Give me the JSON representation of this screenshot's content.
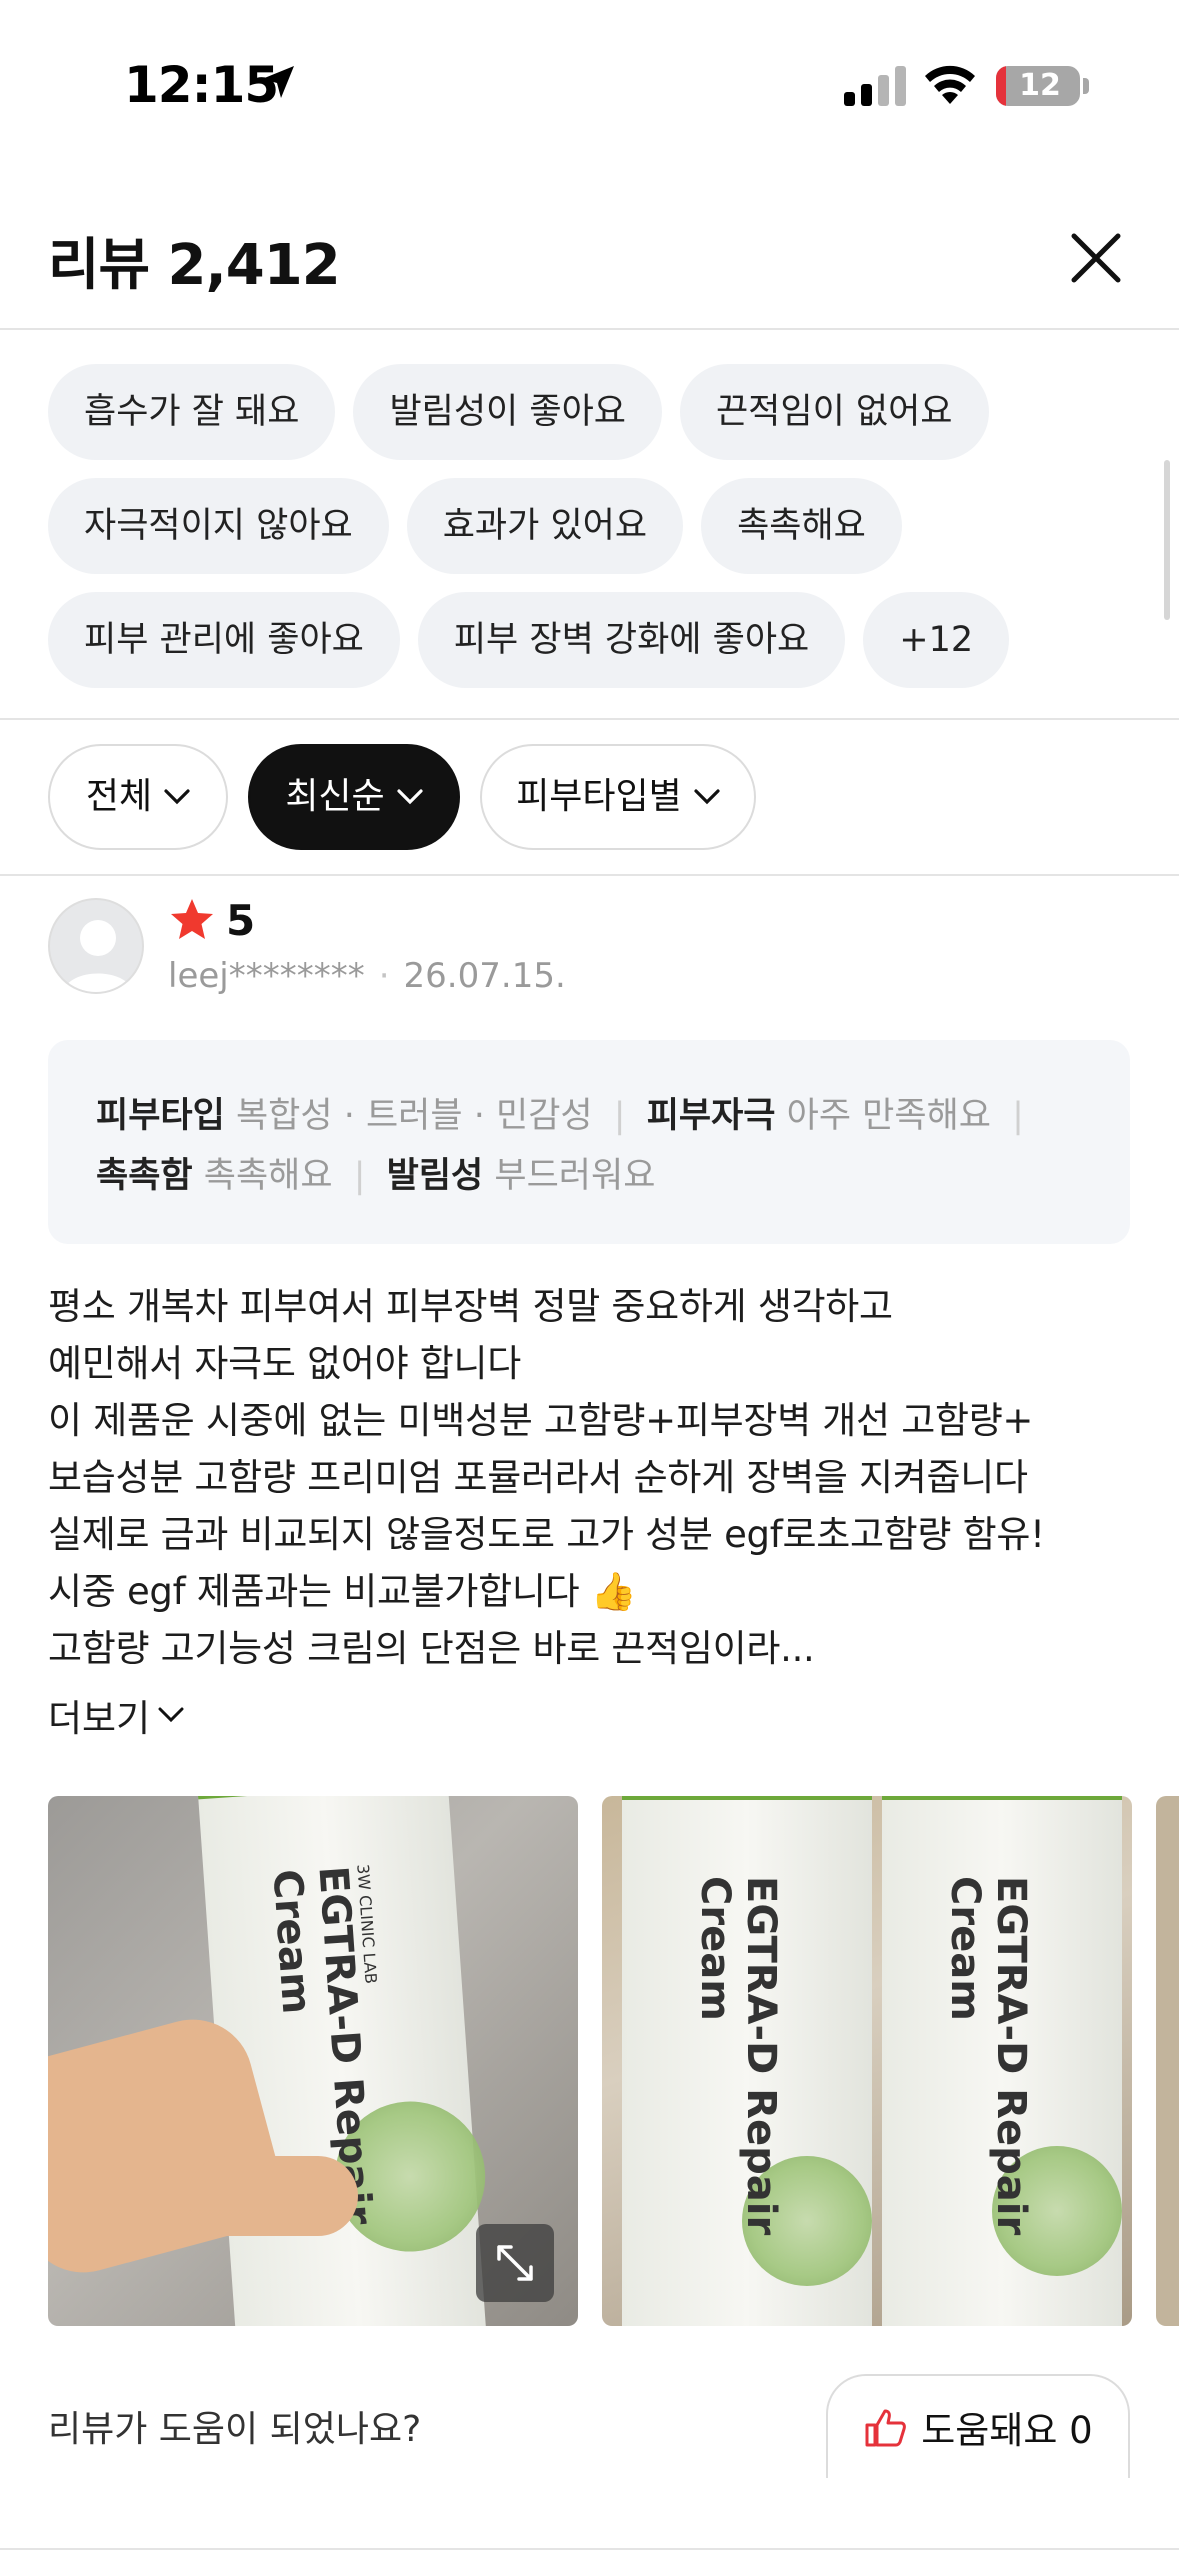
{
  "status_bar": {
    "time": "12:15",
    "battery_level": "12",
    "battery_fraction": 0.12
  },
  "header": {
    "title": "리뷰 2,412",
    "close_icon": "close-icon"
  },
  "keywords": {
    "rows": [
      [
        "흡수가 잘 돼요",
        "발림성이 좋아요",
        "끈적임이 없어요"
      ],
      [
        "자극적이지 않아요",
        "효과가 있어요",
        "촉촉해요"
      ],
      [
        "피부 관리에 좋아요",
        "피부 장벽 강화에 좋아요",
        "+12"
      ]
    ]
  },
  "sort": {
    "all": "전체",
    "latest": "최신순",
    "skin_type": "피부타입별"
  },
  "review": {
    "rating": "5",
    "author": "leej********",
    "date": "26.07.15.",
    "attributes": {
      "skin_type_key": "피부타입",
      "skin_type_values": [
        "복합성",
        "트러블",
        "민감성"
      ],
      "irritation_key": "피부자극",
      "irritation_value": "아주 만족해요",
      "moisture_key": "촉촉함",
      "moisture_value": "촉촉해요",
      "spread_key": "발림성",
      "spread_value": "부드러워요"
    },
    "text": "평소 개복차 피부여서 피부장벽 정말 중요하게 생각하고\n예민해서 자극도 없어야 합니다\n이 제품운 시중에 없는 미백성분 고함량+피부장벽 개선 고함량+\n보습성분 고함량 프리미엄 포뮬러라서 순하게 장벽을 지켜줍니다\n실제로 금과 비교되지 않을정도로 고가 성분 egf로초고함량 함유!\n시중 egf 제품과는 비교불가합니다 👍\n고함량 고기능성 크림의 단점은  바로 끈적임이라...",
    "more": "더보기",
    "photo_label_brand": "3W CLINIC LAB",
    "photo_label_product": "EGTRA-D Repair Cream"
  },
  "helpful": {
    "question": "리뷰가 도움이 되었나요?",
    "button_label": "도움돼요 0"
  },
  "colors": {
    "star": "#f0392e",
    "active_chip": "#111111",
    "chip_bg": "#f0f2f5",
    "thumb": "#e5323b"
  }
}
